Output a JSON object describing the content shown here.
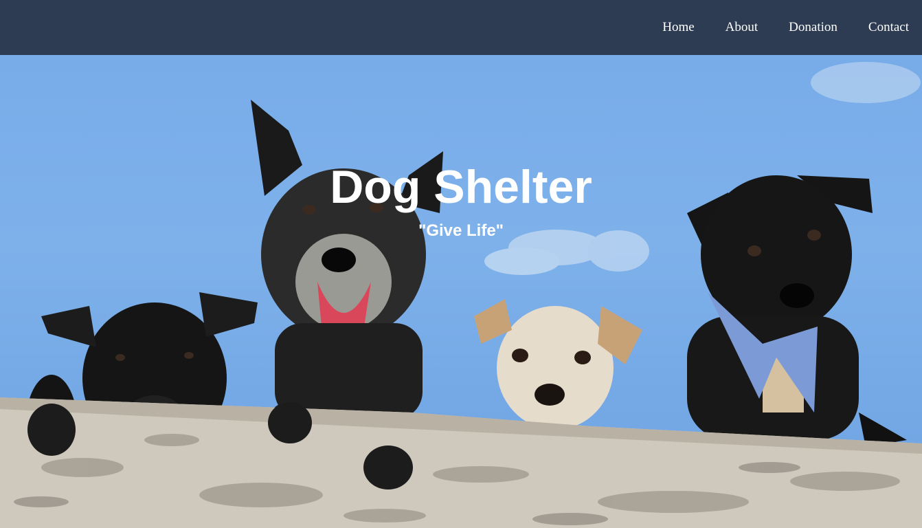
{
  "nav": {
    "items": [
      {
        "label": "Home"
      },
      {
        "label": "About"
      },
      {
        "label": "Donation"
      },
      {
        "label": "Contact"
      }
    ]
  },
  "hero": {
    "title": "Dog Shelter",
    "tagline": "\"Give Life\"",
    "image_icon": "dogs-over-wall-photo"
  },
  "colors": {
    "navbar": "#2d3c53",
    "sky": "#78ace9",
    "text": "#ffffff"
  }
}
